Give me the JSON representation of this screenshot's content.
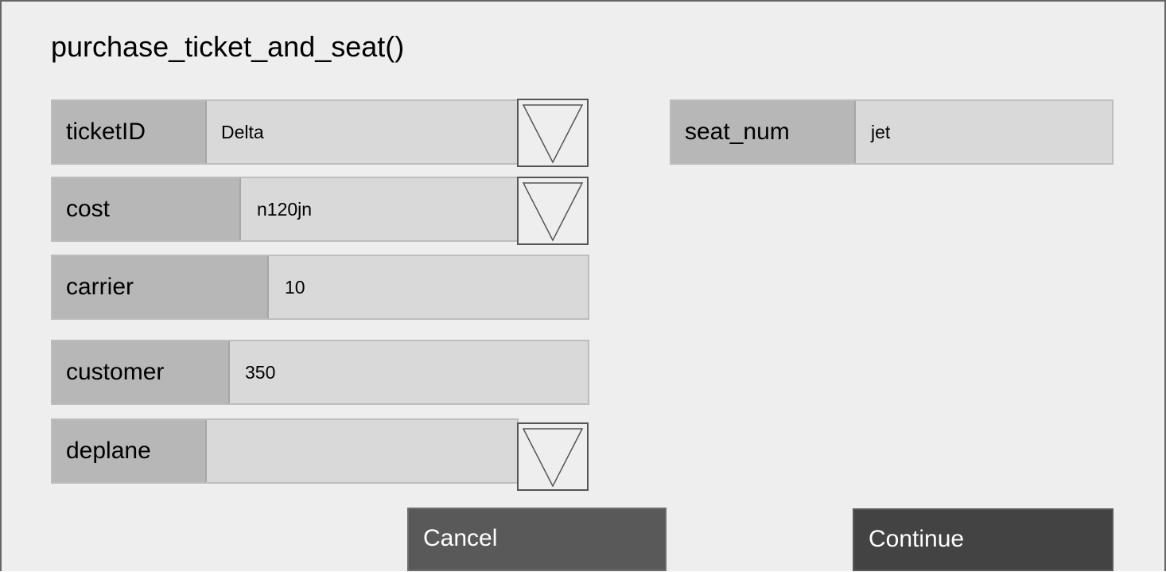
{
  "dialog": {
    "title": "purchase_ticket_and_seat()"
  },
  "fields": {
    "ticketID": {
      "label": "ticketID",
      "value": "Delta"
    },
    "cost": {
      "label": "cost",
      "value": "n120jn"
    },
    "carrier": {
      "label": "carrier",
      "value": "10"
    },
    "customer": {
      "label": "customer",
      "value": "350"
    },
    "deplane": {
      "label": "deplane",
      "value": ""
    },
    "seat_num": {
      "label": "seat_num",
      "value": "jet"
    }
  },
  "icons": {
    "dropdown": "triangle-down-icon"
  },
  "buttons": {
    "cancel": "Cancel",
    "continue": "Continue"
  },
  "colors": {
    "background": "#eeeeee",
    "label_bg": "#b7b7b7",
    "field_bg": "#d9d9d9",
    "cancel_bg": "#595959",
    "continue_bg": "#434343"
  }
}
